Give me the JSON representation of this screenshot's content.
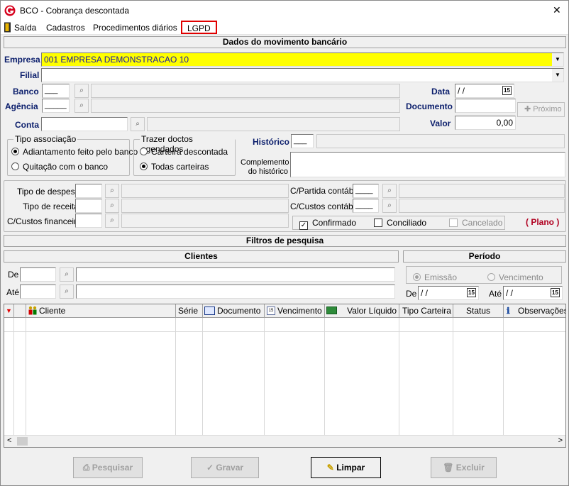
{
  "window": {
    "title": "BCO - Cobrança descontada",
    "close_glyph": "✕"
  },
  "menu": {
    "items": [
      "Saída",
      "Cadastros",
      "Procedimentos diários",
      "LGPD"
    ]
  },
  "section1": {
    "title": "Dados do movimento bancário",
    "empresa_label": "Empresa",
    "empresa_value": "001 EMPRESA DEMONSTRACAO 10",
    "filial_label": "Filial",
    "banco_label": "Banco",
    "banco_value": "___",
    "agencia_label": "Agência",
    "agencia_value": "_____",
    "conta_label": "Conta",
    "data_label": "Data",
    "data_value": " / /",
    "documento_label": "Documento",
    "valor_label": "Valor",
    "valor_value": "0,00",
    "proximo_label": "Próximo",
    "historico_label": "Histórico",
    "historico_value": "___",
    "complemento_label_1": "Complemento",
    "complemento_label_2": "do histórico",
    "calendar_glyph": "15"
  },
  "tipo_associacao": {
    "title": "Tipo associação",
    "options": [
      "Adiantamento feito pelo banco",
      "Quitação com o banco"
    ],
    "selected": 0
  },
  "trazer_doctos": {
    "title": "Trazer doctos agendados",
    "options": [
      "Carteira descontada",
      "Todas carteiras"
    ],
    "selected": 1
  },
  "contabil": {
    "tipo_despesa": "Tipo de despesa",
    "tipo_receita": "Tipo de receita",
    "custos_financeiro": "C/Custos financeiro",
    "partida_contabil": "C/Partida contábil",
    "custos_contabil": "C/Custos contábil",
    "confirmado": "Confirmado",
    "conciliado": "Conciliado",
    "cancelado": "Cancelado",
    "plano": "( Plano  )"
  },
  "filtros": {
    "title": "Filtros de pesquisa",
    "clientes_title": "Clientes",
    "de_label": "De",
    "ate_label": "Até",
    "periodo_title": "Período",
    "emissao": "Emissão",
    "vencimento": "Vencimento",
    "de_date": " / /",
    "ate_date": " / /"
  },
  "grid": {
    "columns": [
      "Cliente",
      "Série",
      "Documento",
      "Vencimento",
      "Valor Líquido",
      "Tipo Carteira",
      "Status",
      "Observações"
    ]
  },
  "buttons": {
    "pesquisar": "Pesquisar",
    "gravar": "Gravar",
    "limpar": "Limpar",
    "excluir": "Excluir"
  },
  "colors": {
    "menu_highlight": "#e00000",
    "empresa_bg": "#ffff00",
    "label_blue": "#0a1d6b",
    "plano_red": "#b00020"
  }
}
